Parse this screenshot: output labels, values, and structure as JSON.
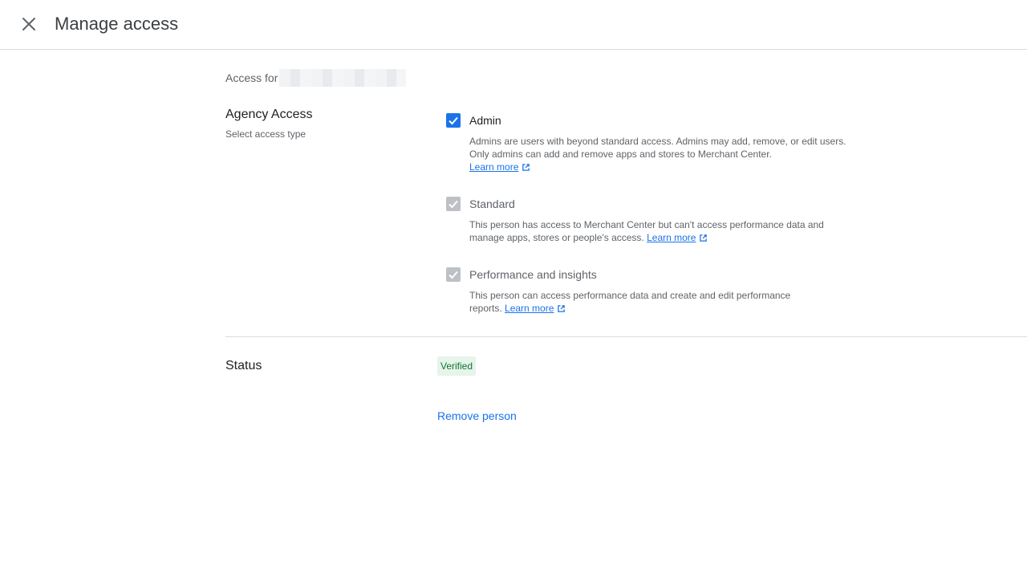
{
  "header": {
    "title": "Manage access",
    "close_icon": "close-icon"
  },
  "access_for": {
    "label": "Access for"
  },
  "agency_access": {
    "title": "Agency Access",
    "subtitle": "Select access type",
    "options": [
      {
        "label": "Admin",
        "checked": true,
        "disabled": false,
        "description": "Admins are users with beyond standard access. Admins may add, remove, or edit users. Only admins can add and remove apps and stores to Merchant Center.",
        "link": "Learn more"
      },
      {
        "label": "Standard",
        "checked": true,
        "disabled": true,
        "description": "This person has access to Merchant Center but can't access performance data and manage apps, stores or people's access.",
        "link": "Learn more"
      },
      {
        "label": "Performance and insights",
        "checked": true,
        "disabled": true,
        "description": "This person can access performance data and create and edit performance reports.",
        "link": "Learn more"
      }
    ]
  },
  "status": {
    "title": "Status",
    "value": "Verified"
  },
  "actions": {
    "remove_label": "Remove person"
  },
  "colors": {
    "accent": "#1a73e8",
    "verified_bg": "#e6f4ea",
    "verified_text": "#137333",
    "disabled_check": "#bdc1c6"
  }
}
